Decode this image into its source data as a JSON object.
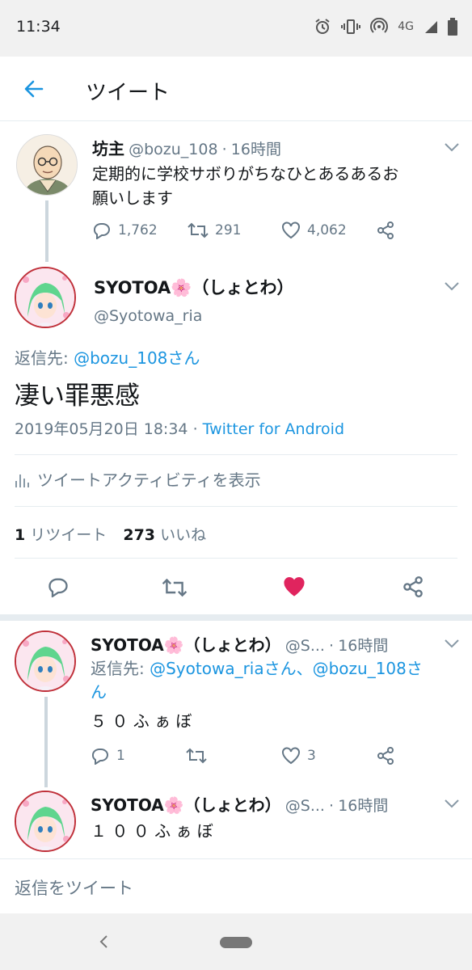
{
  "status_bar": {
    "time": "11:34",
    "network": "4G"
  },
  "header": {
    "title": "ツイート"
  },
  "parent_tweet": {
    "name": "坊主",
    "handle": "@bozu_108",
    "separator": "·",
    "time": "16時間",
    "text_line1": "定期的に学校サボりがちなひとあるあるお",
    "text_line2": "願いします",
    "replies": "1,762",
    "retweets": "291",
    "likes": "4,062"
  },
  "main_tweet": {
    "name": "SYOTOA🌸（しょとわ）",
    "handle": "@Syotowa_ria",
    "reply_to_label": "返信先:",
    "reply_to_user": "@bozu_108さん",
    "text": "凄い罪悪感",
    "timestamp": "2019年05月20日 18:34",
    "separator": "·",
    "source": "Twitter for Android",
    "activity_label": "ツイートアクティビティを表示",
    "retweet_count": "1",
    "retweet_label": "リツイート",
    "like_count": "273",
    "like_label": "いいね",
    "liked": true
  },
  "reply_1": {
    "name": "SYOTOA🌸（しょとわ）",
    "handle": "@S...",
    "separator": "·",
    "time": "16時間",
    "reply_to_label": "返信先:",
    "reply_to_users": "@Syotowa_riaさん、@bozu_108さ",
    "reply_to_cont": "ん",
    "text": "５ ０ ふ ぁ ぼ",
    "replies": "1",
    "likes": "3"
  },
  "reply_2": {
    "name": "SYOTOA🌸（しょとわ）",
    "handle": "@S...",
    "separator": "·",
    "time": "16時間",
    "text": "１ ０ ０ ふ ぁ ぼ"
  },
  "reply_bar": {
    "placeholder": "返信をツイート"
  },
  "colors": {
    "accent": "#1b95e0",
    "like": "#e0245e",
    "muted": "#657786"
  }
}
